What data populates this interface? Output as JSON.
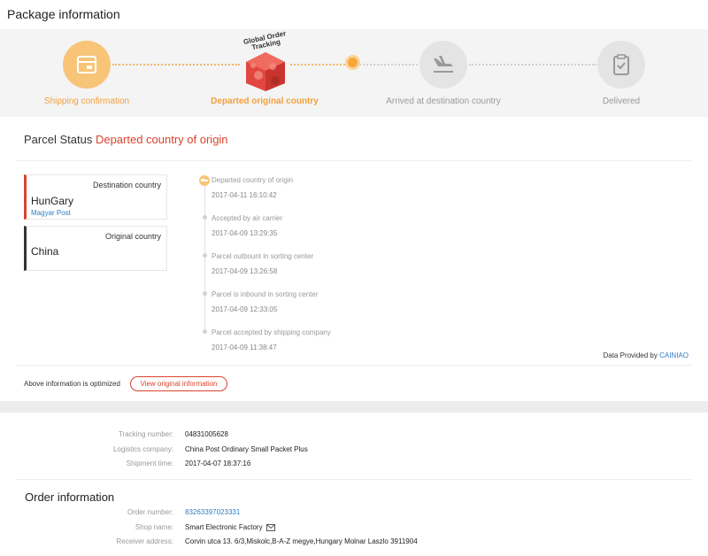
{
  "header": {
    "title": "Package information"
  },
  "progress": {
    "steps": [
      {
        "label": "Shipping confirmation",
        "state": "done",
        "icon": "package-icon"
      },
      {
        "label": "Departed original country",
        "state": "current",
        "icon": "globe-box-icon"
      },
      {
        "label": "Arrived at destination country",
        "state": "pending",
        "icon": "plane-landing-icon"
      },
      {
        "label": "Delivered",
        "state": "pending",
        "icon": "clipboard-check-icon"
      }
    ],
    "badge_text_1": "Global Order",
    "badge_text_2": "Tracking"
  },
  "parcel": {
    "status_label": "Parcel Status",
    "status_value": "Departed country of origin"
  },
  "cards": {
    "destination": {
      "title": "Destination country",
      "name": "HunGary",
      "carrier": "Magyar Post"
    },
    "origin": {
      "title": "Original country",
      "name": "China"
    }
  },
  "timeline": [
    {
      "event": "Departed country of origin",
      "time": "2017-04-11 16:10:42"
    },
    {
      "event": "Accepted by air carrier",
      "time": "2017-04-09 13:29:35"
    },
    {
      "event": "Parcel outbount in sorting center",
      "time": "2017-04-09 13:26:58"
    },
    {
      "event": "Parcel is inbound in sorting center",
      "time": "2017-04-09 12:33:05"
    },
    {
      "event": "Parcel accepted by shipping company",
      "time": "2017-04-09 11:38:47"
    }
  ],
  "provider": {
    "label": "Data Provided by",
    "name": "CAINIAO"
  },
  "optimized": {
    "text": "Above information is optimized",
    "button": "View original information"
  },
  "shipment": {
    "tracking_label": "Tracking number:",
    "tracking_value": "04831005628",
    "company_label": "Logistics company:",
    "company_value": "China Post Ordinary Small Packet Plus",
    "time_label": "Shipment time:",
    "time_value": "2017-04-07 18:37:16"
  },
  "order": {
    "title": "Order information",
    "number_label": "Order number:",
    "number_value": "83263397023331",
    "shop_label": "Shop name:",
    "shop_value": "Smart Electronic Factory",
    "address_label": "Receiver address:",
    "address_value": "Corvin utca 13. 6/3,Miskolc,B-A-Z megye,Hungary Molnar Laszlo 3911904"
  },
  "colors": {
    "accent": "#f2a03c",
    "alert": "#d9432d",
    "link": "#2e7dc9"
  }
}
